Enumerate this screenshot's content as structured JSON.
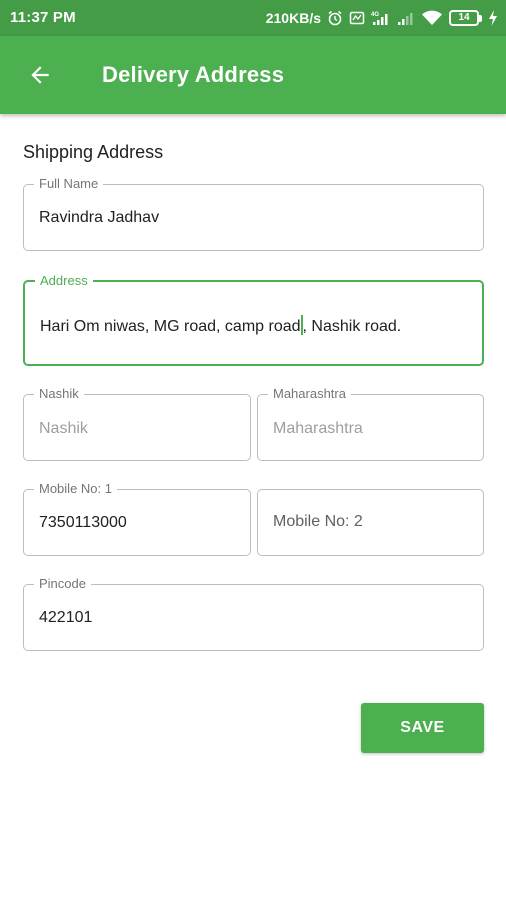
{
  "status_bar": {
    "time": "11:37 PM",
    "network_speed": "210KB/s",
    "battery_level": "14",
    "icons": [
      "alarm-icon",
      "data-saver-icon",
      "signal-4g-icon",
      "signal-icon",
      "wifi-icon",
      "battery-icon",
      "charging-icon"
    ]
  },
  "app_bar": {
    "title": "Delivery Address",
    "back_icon": "arrow-left-icon",
    "background_color": "#4caf50"
  },
  "form": {
    "section_title": "Shipping Address",
    "full_name": {
      "label": "Full Name",
      "value": "Ravindra Jadhav"
    },
    "address": {
      "label": "Address",
      "value_before_cursor": "Hari Om niwas, MG road, camp road",
      "value_after_cursor": ", Nashik road."
    },
    "city": {
      "label": "Nashik",
      "hint": "Nashik"
    },
    "state": {
      "label": "Maharashtra",
      "hint": "Maharashtra"
    },
    "mobile_1": {
      "label": "Mobile No: 1",
      "value": "7350113000"
    },
    "mobile_2": {
      "placeholder": "Mobile No: 2"
    },
    "pincode": {
      "label": "Pincode",
      "value": "422101"
    }
  },
  "actions": {
    "save_label": "SAVE"
  },
  "colors": {
    "accent": "#4caf50",
    "status_bar": "#449c47",
    "field_border": "#bdbdbd"
  }
}
